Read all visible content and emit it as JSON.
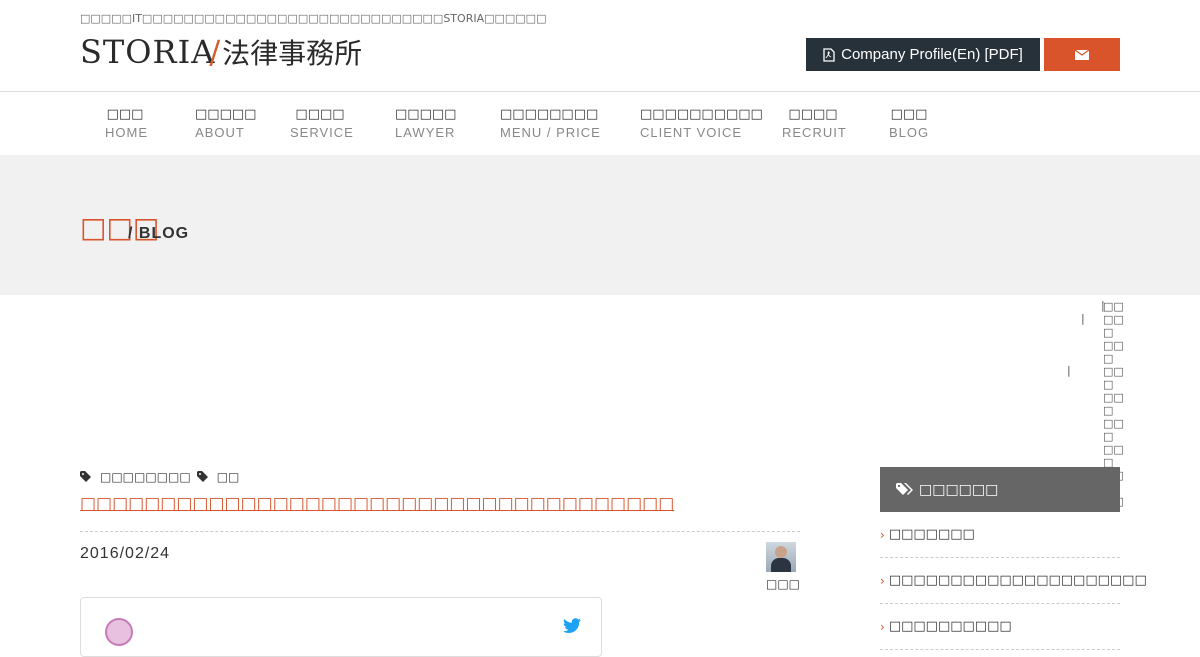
{
  "header": {
    "tagline": "□□□□□IT□□□□□□□□□□□□□□□□□□□□□□□□□□□□□STORIA□□□□□□",
    "logo_en": "STORIA",
    "logo_jp": "法律事務所",
    "profile_button": "Company Profile(En) [PDF]"
  },
  "nav": [
    {
      "jp": "□□□",
      "en": "HOME"
    },
    {
      "jp": "□□□□□",
      "en": "ABOUT"
    },
    {
      "jp": "□□□□",
      "en": "SERVICE"
    },
    {
      "jp": "□□□□□",
      "en": "LAWYER"
    },
    {
      "jp": "□□□□□□□□",
      "en": "MENU / PRICE"
    },
    {
      "jp": "□□□□□□□□□□",
      "en": "CLIENT VOICE"
    },
    {
      "jp": "□□□□",
      "en": "RECRUIT"
    },
    {
      "jp": "□□□",
      "en": "BLOG"
    }
  ],
  "hero": {
    "jp": "□□□",
    "en": "/ BLOG"
  },
  "vertical_text": {
    "bar1": "|",
    "bar2": "|",
    "bar3": "|",
    "col": "□□ □□□ □□□ □□□ □□□ □□□ □□□ □□□ □□"
  },
  "post": {
    "category1": "□□□□□□□□",
    "category2": "□□",
    "title": "□□□□□□□□□□□□□□□□□□□□□□□□□□□□□□□□□□□□□",
    "date": "2016/02/24",
    "author": "□□□"
  },
  "sidebar": {
    "heading": "□□□□□□",
    "items": [
      "□□□□□□□",
      "□□□□□□□□□□□□□□□□□□□□□",
      "□□□□□□□□□□"
    ]
  },
  "colors": {
    "accent": "#d9532b",
    "dark": "#27313a",
    "sidebar_head": "#666666",
    "hero_bg": "#f1f1f1"
  },
  "icons": [
    "file-pdf-icon",
    "envelope-icon",
    "tags-icon",
    "twitter-icon",
    "chevron-right-icon"
  ]
}
